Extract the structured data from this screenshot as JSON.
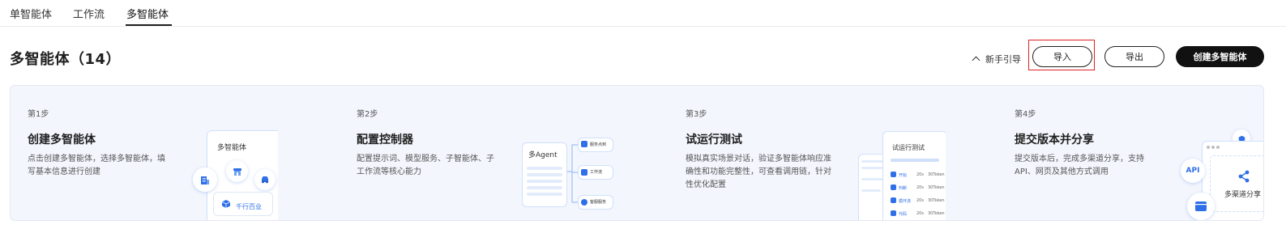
{
  "tabs": {
    "single": "单智能体",
    "workflow": "工作流",
    "multi": "多智能体"
  },
  "header": {
    "title": "多智能体（14）",
    "guide_label": "新手引导",
    "import_label": "导入",
    "export_label": "导出",
    "create_label": "创建多智能体"
  },
  "steps": [
    {
      "num": "第1步",
      "title": "创建多智能体",
      "desc": "点击创建多智能体，选择多智能体，填写基本信息进行创建",
      "illus": {
        "card_title": "多智能体",
        "pill": "千行百业"
      }
    },
    {
      "num": "第2步",
      "title": "配置控制器",
      "desc": "配置提示词、模型服务、子智能体、子工作流等核心能力",
      "illus": {
        "card_title": "多Agent",
        "node1": "服务点到",
        "node2": "工作流",
        "node3": "客服服务"
      }
    },
    {
      "num": "第3步",
      "title": "试运行测试",
      "desc": "模拟真实场景对话，验证多智能体响应准确性和功能完整性，可查看调用链，针对性优化配置",
      "illus": {
        "card_title": "试运行测试",
        "rows": [
          {
            "name": "开始",
            "t": "20s",
            "tok": "30Token"
          },
          {
            "name": "判断",
            "t": "20s",
            "tok": "30Token"
          },
          {
            "name": "循环流",
            "t": "20s",
            "tok": "30Token"
          },
          {
            "name": "代码",
            "t": "20s",
            "tok": "30Token"
          }
        ]
      }
    },
    {
      "num": "第4步",
      "title": "提交版本并分享",
      "desc": "提交版本后，完成多渠道分享，支持API、网页及其他方式调用",
      "illus": {
        "api": "API",
        "share": "多渠道分享"
      }
    }
  ],
  "colors": {
    "accent": "#2f6fe8",
    "highlight": "#e02020",
    "panel_bg": "#f3f6fd"
  }
}
